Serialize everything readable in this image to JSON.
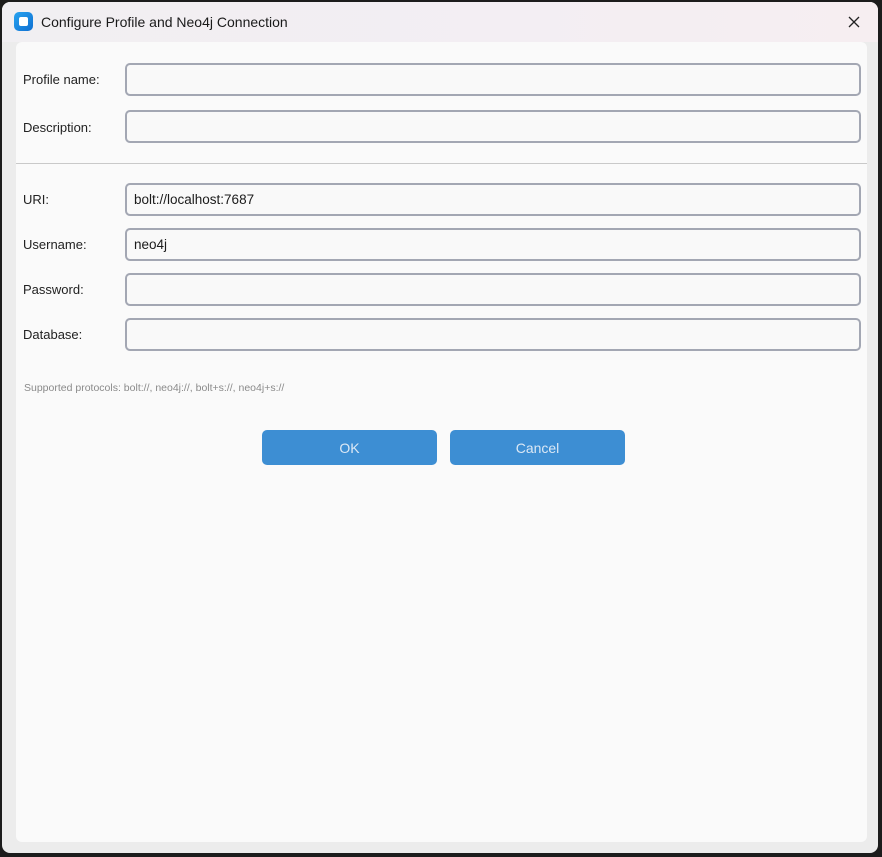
{
  "window": {
    "title": "Configure Profile and Neo4j Connection"
  },
  "profile": {
    "name_label": "Profile name:",
    "name_value": "",
    "description_label": "Description:",
    "description_value": ""
  },
  "connection": {
    "uri_label": "URI:",
    "uri_value": "bolt://localhost:7687",
    "username_label": "Username:",
    "username_value": "neo4j",
    "password_label": "Password:",
    "password_value": "",
    "database_label": "Database:",
    "database_value": ""
  },
  "hint": "Supported protocols: bolt://, neo4j://, bolt+s://, neo4j+s://",
  "buttons": {
    "ok_label": "OK",
    "cancel_label": "Cancel"
  },
  "colors": {
    "button_bg": "#3d8ed3",
    "input_border": "#a3a7b3",
    "app_icon": "#1a86e0"
  },
  "icons": {
    "app": "app-icon",
    "close": "close-icon"
  }
}
